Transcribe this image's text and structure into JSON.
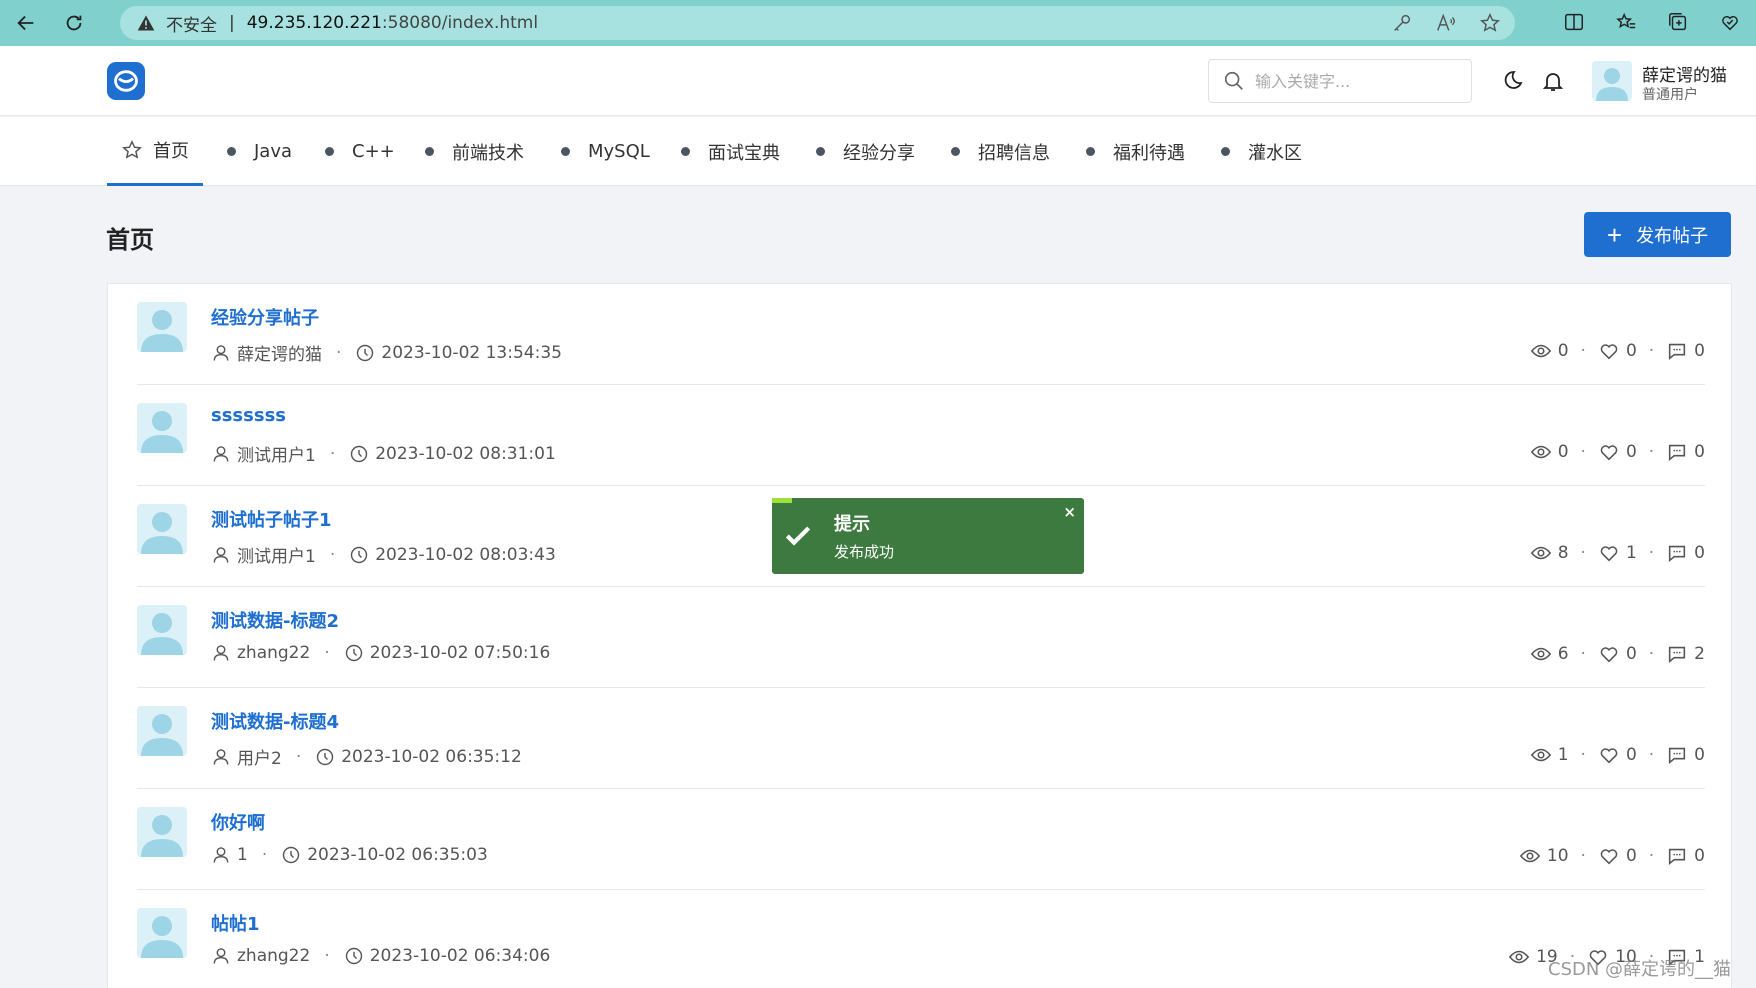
{
  "browser": {
    "insecure_label": "不安全",
    "url_host": "49.235.120.221",
    "url_rest": ":58080/index.html"
  },
  "header": {
    "search_placeholder": "输入关键字...",
    "user_name": "薛定谔的猫",
    "user_role": "普通用户"
  },
  "nav": {
    "items": [
      "首页",
      "Java",
      "C++",
      "前端技术",
      "MySQL",
      "面试宝典",
      "经验分享",
      "招聘信息",
      "福利待遇",
      "灌水区"
    ]
  },
  "page": {
    "title": "首页",
    "publish_label": "发布帖子"
  },
  "posts": [
    {
      "title": "经验分享帖子",
      "author": "薛定谔的猫",
      "time": "2023-10-02 13:54:35",
      "views": "0",
      "likes": "0",
      "comments": "0"
    },
    {
      "title": "sssssss",
      "author": "测试用户1",
      "time": "2023-10-02 08:31:01",
      "views": "0",
      "likes": "0",
      "comments": "0"
    },
    {
      "title": "测试帖子帖子1",
      "author": "测试用户1",
      "time": "2023-10-02 08:03:43",
      "views": "8",
      "likes": "1",
      "comments": "0"
    },
    {
      "title": "测试数据-标题2",
      "author": "zhang22",
      "time": "2023-10-02 07:50:16",
      "views": "6",
      "likes": "0",
      "comments": "2"
    },
    {
      "title": "测试数据-标题4",
      "author": "用户2",
      "time": "2023-10-02 06:35:12",
      "views": "1",
      "likes": "0",
      "comments": "0"
    },
    {
      "title": "你好啊",
      "author": "1",
      "time": "2023-10-02 06:35:03",
      "views": "10",
      "likes": "0",
      "comments": "0"
    },
    {
      "title": "帖帖1",
      "author": "zhang22",
      "time": "2023-10-02 06:34:06",
      "views": "19",
      "likes": "10",
      "comments": "1"
    }
  ],
  "toast": {
    "title": "提示",
    "message": "发布成功",
    "close": "×"
  },
  "watermark": "CSDN @薛定谔的__猫",
  "colors": {
    "accent": "#1f6fd0",
    "toast_bg": "#3d7a3f",
    "browser_bar": "#80d0ce"
  }
}
